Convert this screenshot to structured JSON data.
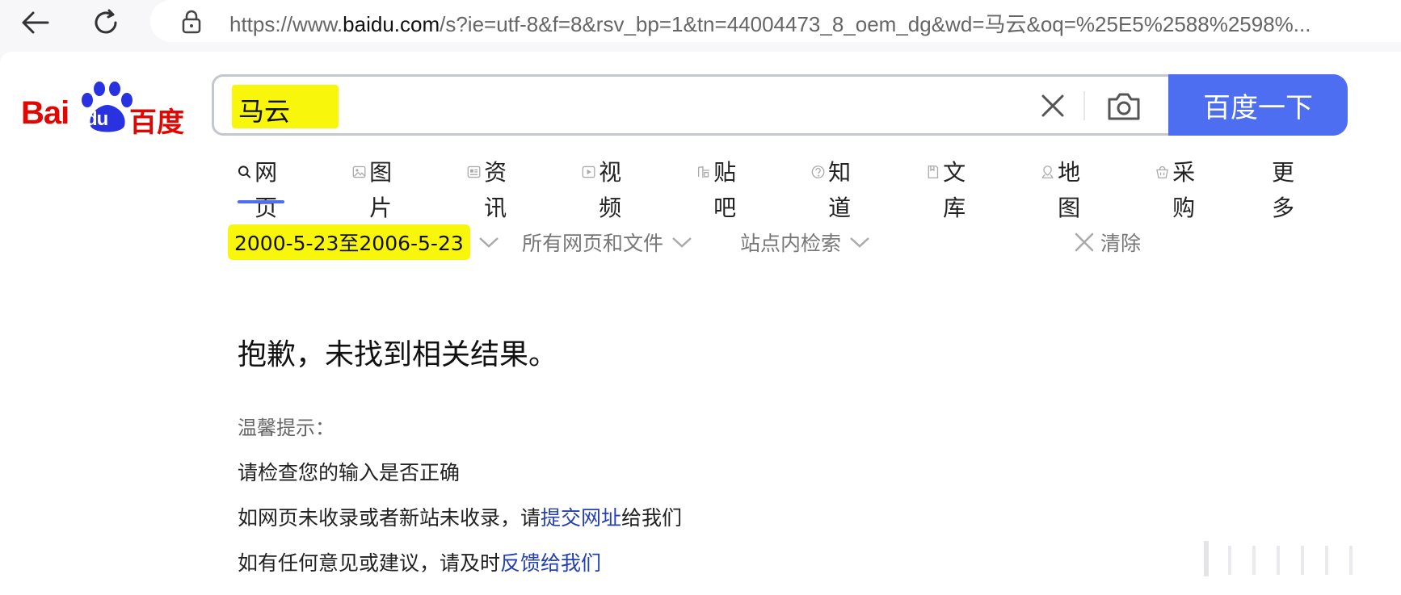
{
  "browser": {
    "url_prefix": "https://www.",
    "url_domain": "baidu.com",
    "url_rest": "/s?ie=utf-8&f=8&rsv_bp=1&tn=44004473_8_oem_dg&wd=马云&oq=%25E5%2588%2598%..."
  },
  "logo": {
    "text_bai": "Bai",
    "text_du": "du",
    "text_cn": "百度"
  },
  "search": {
    "query": "马云",
    "button_label": "百度一下"
  },
  "tabs": [
    {
      "label": "网页",
      "icon": "search-icon"
    },
    {
      "label": "图片",
      "icon": "image-icon"
    },
    {
      "label": "资讯",
      "icon": "news-icon"
    },
    {
      "label": "视频",
      "icon": "video-icon"
    },
    {
      "label": "贴吧",
      "icon": "tieba-icon"
    },
    {
      "label": "知道",
      "icon": "question-icon"
    },
    {
      "label": "文库",
      "icon": "document-icon"
    },
    {
      "label": "地图",
      "icon": "map-icon"
    },
    {
      "label": "采购",
      "icon": "basket-icon"
    },
    {
      "label": "更多",
      "icon": ""
    }
  ],
  "filters": {
    "date_range": "2000-5-23至2006-5-23",
    "file_type": "所有网页和文件",
    "site_search": "站点内检索",
    "clear": "清除"
  },
  "result": {
    "no_result": "抱歉，未找到相关结果。",
    "tip_title": "温馨提示：",
    "tip1": "请检查您的输入是否正确",
    "tip2_prefix": "如网页未收录或者新站未收录，请",
    "tip2_link": "提交网址",
    "tip2_suffix": "给我们",
    "tip3_prefix": "如有任何意见或建议，请及时",
    "tip3_link": "反馈给我们"
  },
  "colors": {
    "brand_red": "#e10602",
    "brand_blue": "#4e6ef2",
    "link": "#2440b3",
    "highlight": "#f8f60a"
  }
}
